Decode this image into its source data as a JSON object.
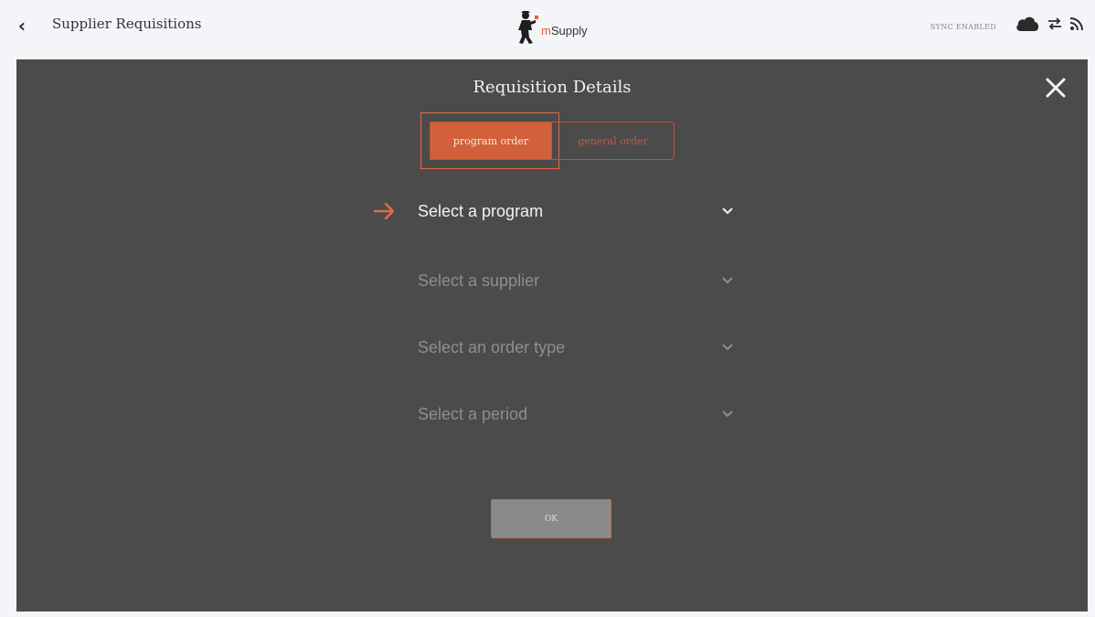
{
  "header": {
    "title": "Supplier Requisitions",
    "logo_prefix": "m",
    "logo_name": "Supply",
    "sync_status": "SYNC ENABLED",
    "icons": [
      "back-chevron-icon",
      "cloud-icon",
      "sync-arrows-icon",
      "rss-icon"
    ]
  },
  "modal": {
    "title": "Requisition Details",
    "tabs": [
      {
        "label": "program order",
        "active": true
      },
      {
        "label": "general order",
        "active": false
      }
    ],
    "dropdowns": [
      {
        "label": "Select a program",
        "enabled": true
      },
      {
        "label": "Select a supplier",
        "enabled": false
      },
      {
        "label": "Select an order type",
        "enabled": false
      },
      {
        "label": "Select a period",
        "enabled": false
      }
    ],
    "ok_label": "OK"
  },
  "colors": {
    "accent": "#d2603a",
    "modal_bg": "#4b4b4b",
    "page_bg": "#f4f5f8"
  }
}
